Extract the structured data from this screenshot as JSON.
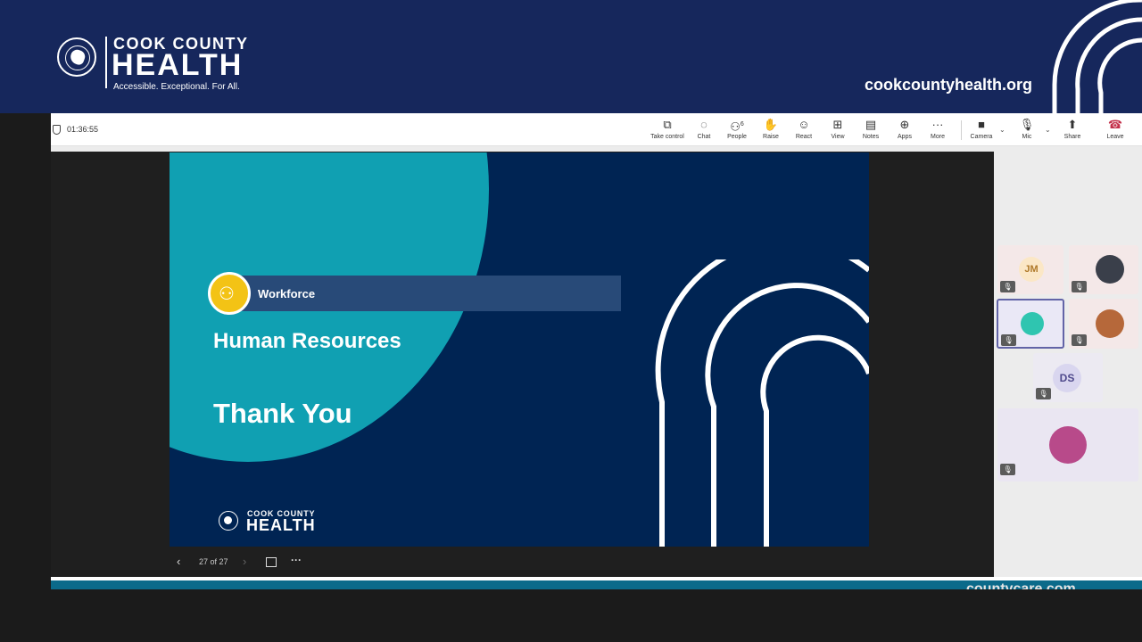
{
  "banner": {
    "logo_top": "COOK COUNTY",
    "logo_main": "HEALTH",
    "tagline": "Accessible. Exceptional. For All.",
    "website": "cookcountyhealth.org"
  },
  "meeting": {
    "timer": "01:36:55",
    "toolbar": {
      "take_control": "Take control",
      "chat": "Chat",
      "people": "People",
      "people_count": "6",
      "raise": "Raise",
      "react": "React",
      "view": "View",
      "notes": "Notes",
      "apps": "Apps",
      "more": "More",
      "camera": "Camera",
      "mic": "Mic",
      "share": "Share",
      "leave": "Leave"
    }
  },
  "slide": {
    "section_label": "Workforce",
    "title": "Human Resources",
    "closing": "Thank You",
    "logo_top": "COOK COUNTY",
    "logo_main": "HEALTH"
  },
  "slide_nav": {
    "count": "27 of 27"
  },
  "participants": [
    {
      "initials": "JM"
    },
    {
      "initials": ""
    },
    {
      "initials": ""
    },
    {
      "initials": ""
    },
    {
      "initials": "DS"
    },
    {
      "initials": ""
    }
  ],
  "footer": {
    "partial_url": "countycare.com"
  },
  "colors": {
    "banner_navy": "#16275c",
    "slide_navy": "#002453",
    "slide_teal": "#10a0b2",
    "workforce_yellow": "#f3c315",
    "teams_purple": "#6264a7",
    "leave_red": "#c4314b"
  }
}
